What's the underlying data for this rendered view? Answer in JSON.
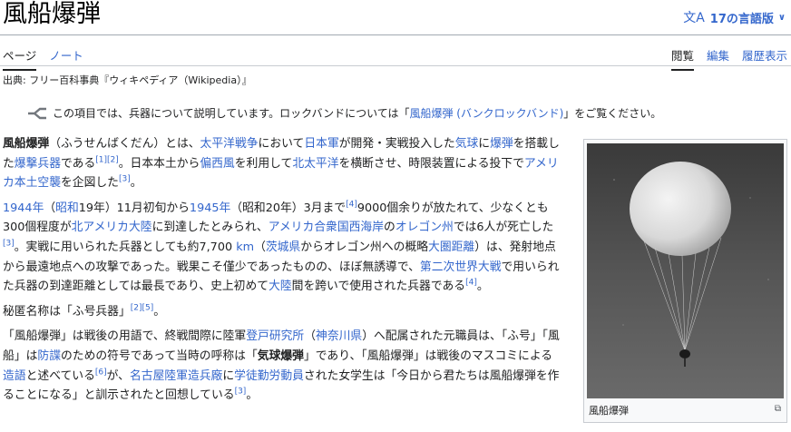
{
  "page": {
    "title": "風船爆弾",
    "language_button": "17の言語版",
    "tabs_left": [
      "ページ",
      "ノート"
    ],
    "tabs_right": [
      "閲覧",
      "編集",
      "履歴表示"
    ],
    "source": "出典: フリー百科事典『ウィキペディア（Wikipedia）』"
  },
  "hatnote": {
    "before": "この項目では、兵器について説明しています。ロックバンドについては「",
    "link": "風船爆弾 (バンクロックバンド)",
    "after": "」をご覧ください。"
  },
  "infobox": {
    "caption": "風船爆弾"
  },
  "colors": {
    "link": "#3366cc",
    "text": "#202122",
    "border": "#a2a9b1"
  }
}
